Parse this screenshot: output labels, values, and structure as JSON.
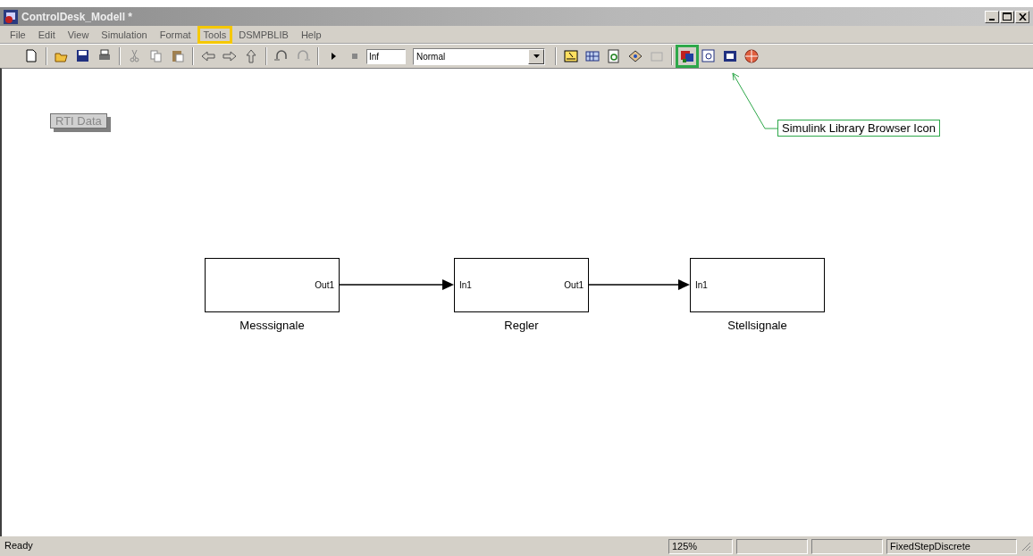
{
  "window": {
    "title": "ControlDesk_Modell *"
  },
  "menu": [
    {
      "label": "File",
      "highlighted": false
    },
    {
      "label": "Edit",
      "highlighted": false
    },
    {
      "label": "View",
      "highlighted": false
    },
    {
      "label": "Simulation",
      "highlighted": false
    },
    {
      "label": "Format",
      "highlighted": false
    },
    {
      "label": "Tools",
      "highlighted": true
    },
    {
      "label": "DSMPBLIB",
      "highlighted": false
    },
    {
      "label": "Help",
      "highlighted": false
    }
  ],
  "toolbar": {
    "stop_time": "Inf",
    "mode": "Normal",
    "library_icon_highlighted": true
  },
  "annotation": {
    "text": "Simulink Library Browser Icon"
  },
  "canvas": {
    "tag": "RTI Data",
    "blocks": [
      {
        "name": "Messsignale",
        "out_port": "Out1"
      },
      {
        "name": "Regler",
        "in_port": "In1",
        "out_port": "Out1"
      },
      {
        "name": "Stellsignale",
        "in_port": "In1"
      }
    ]
  },
  "status_bar": {
    "message": "Ready",
    "zoom": "125%",
    "solver": "FixedStepDiscrete"
  }
}
